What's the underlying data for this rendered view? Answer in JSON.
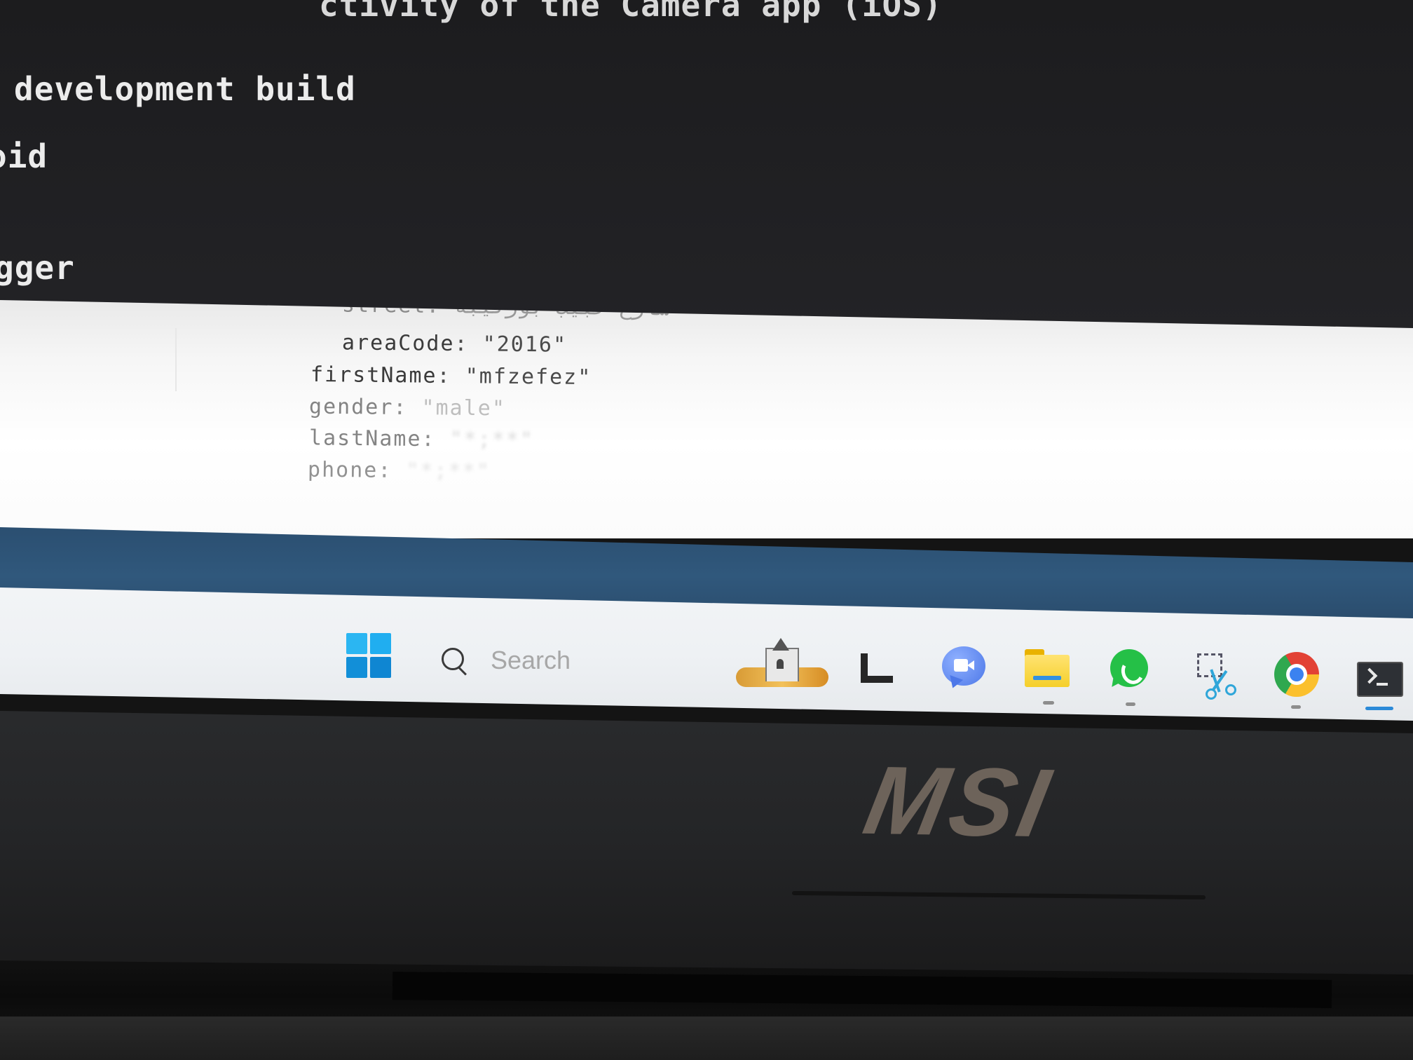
{
  "terminal": {
    "lines": [
      "ctivity of the Camera app (iOS)",
      "development build",
      "oid",
      "gger"
    ]
  },
  "console": {
    "street": {
      "key": "street",
      "value": "شارع حبيب بورقيبة"
    },
    "areaCode": {
      "key": "areaCode",
      "value": "\"2016\""
    },
    "firstName": {
      "key": "firstName",
      "value": "\"mfzefez\""
    },
    "gender": {
      "key": "gender",
      "value": "\"male\""
    },
    "lastName": {
      "key": "lastName",
      "value": "\"*;**\""
    },
    "phone": {
      "key": "phone",
      "value": "\"*;**\""
    },
    "separator": ": "
  },
  "taskbar": {
    "search_placeholder": "Search",
    "icons": [
      "windows-start-icon",
      "search-icon",
      "weather-widget-icon",
      "l-app-icon",
      "video-meeting-icon",
      "file-explorer-icon",
      "whatsapp-icon",
      "snipping-tool-icon",
      "chrome-icon",
      "terminal-icon"
    ],
    "running": [
      "file-explorer",
      "whatsapp",
      "chrome",
      "terminal"
    ],
    "active": "terminal"
  },
  "hardware": {
    "brand": "MSI"
  },
  "colors": {
    "terminal_bg": "#1f1f21",
    "console_bg": "#ffffff",
    "band_blue": "#2f567a",
    "taskbar_bg": "#eef1f4",
    "accent": "#2b8ad8"
  }
}
